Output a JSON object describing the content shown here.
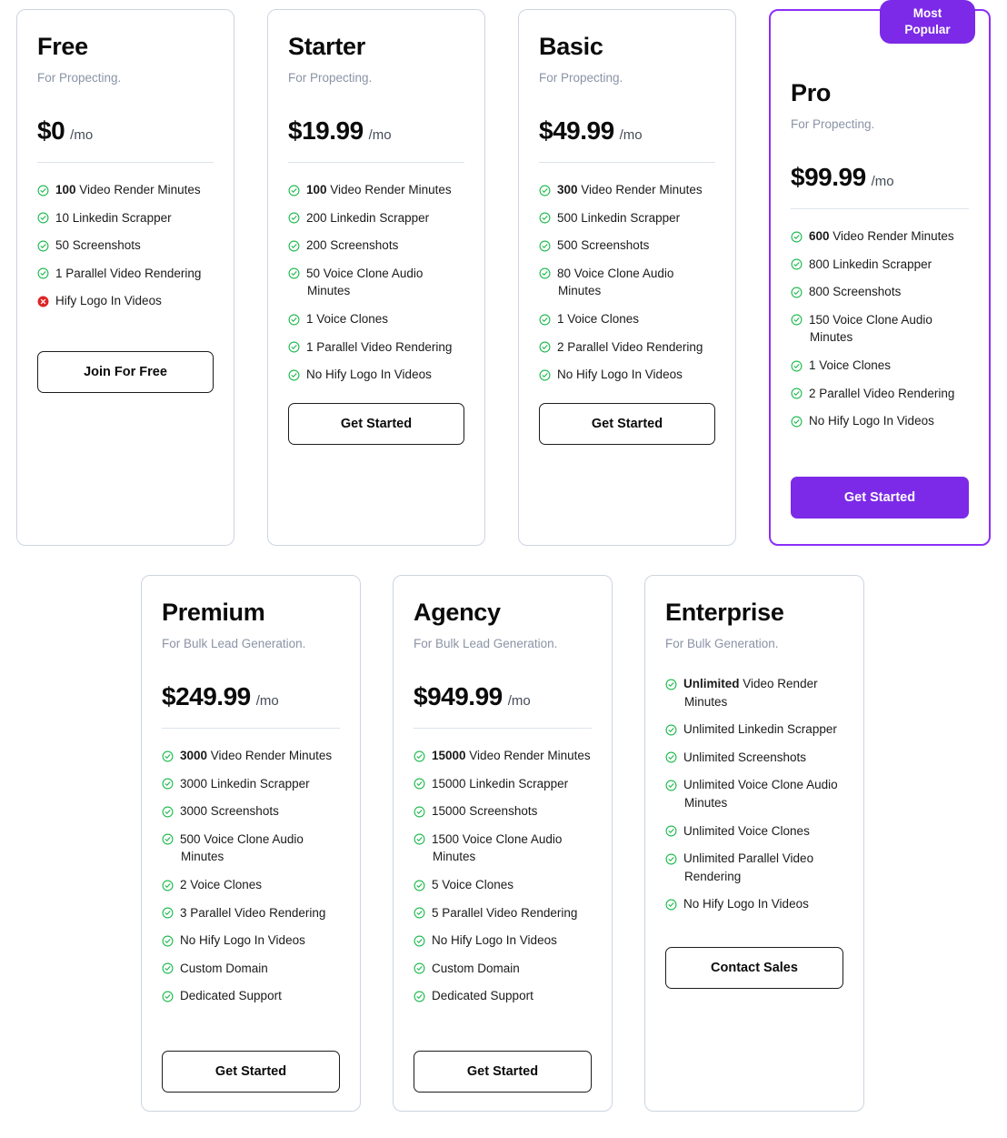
{
  "badge": {
    "line1": "Most",
    "line2": "Popular"
  },
  "colors": {
    "accent": "#7c2ae8",
    "featured_border": "#8b2ff7",
    "card_border": "#cdd5e0",
    "check": "#18b84a",
    "cross": "#e02424",
    "subtitle": "#8a94a6"
  },
  "plans": [
    {
      "name": "Free",
      "subtitle": "For Propecting.",
      "price": "$0",
      "period": "/mo",
      "cta": "Join For Free",
      "features": [
        {
          "icon": "check-icon",
          "strong": "100",
          "text": " Video Render Minutes"
        },
        {
          "icon": "check-icon",
          "strong": "",
          "text": "10 Linkedin Scrapper"
        },
        {
          "icon": "check-icon",
          "strong": "",
          "text": "50 Screenshots"
        },
        {
          "icon": "check-icon",
          "strong": "",
          "text": "1 Parallel Video Rendering"
        },
        {
          "icon": "cross-icon",
          "strong": "",
          "text": "Hify Logo In Videos"
        }
      ]
    },
    {
      "name": "Starter",
      "subtitle": "For Propecting.",
      "price": "$19.99",
      "period": "/mo",
      "cta": "Get Started",
      "features": [
        {
          "icon": "check-icon",
          "strong": "100",
          "text": " Video Render Minutes"
        },
        {
          "icon": "check-icon",
          "strong": "",
          "text": "200 Linkedin Scrapper"
        },
        {
          "icon": "check-icon",
          "strong": "",
          "text": "200 Screenshots"
        },
        {
          "icon": "check-icon",
          "strong": "",
          "text": "50 Voice Clone Audio Minutes"
        },
        {
          "icon": "check-icon",
          "strong": "",
          "text": "1 Voice Clones"
        },
        {
          "icon": "check-icon",
          "strong": "",
          "text": "1 Parallel Video Rendering"
        },
        {
          "icon": "check-icon",
          "strong": "",
          "text": "No Hify Logo In Videos"
        }
      ]
    },
    {
      "name": "Basic",
      "subtitle": "For Propecting.",
      "price": "$49.99",
      "period": "/mo",
      "cta": "Get Started",
      "features": [
        {
          "icon": "check-icon",
          "strong": "300",
          "text": " Video Render Minutes"
        },
        {
          "icon": "check-icon",
          "strong": "",
          "text": "500 Linkedin Scrapper"
        },
        {
          "icon": "check-icon",
          "strong": "",
          "text": "500 Screenshots"
        },
        {
          "icon": "check-icon",
          "strong": "",
          "text": "80 Voice Clone Audio Minutes"
        },
        {
          "icon": "check-icon",
          "strong": "",
          "text": "1 Voice Clones"
        },
        {
          "icon": "check-icon",
          "strong": "",
          "text": "2 Parallel Video Rendering"
        },
        {
          "icon": "check-icon",
          "strong": "",
          "text": "No Hify Logo In Videos"
        }
      ]
    },
    {
      "name": "Pro",
      "subtitle": "For Propecting.",
      "price": "$99.99",
      "period": "/mo",
      "cta": "Get Started",
      "featured": true,
      "features": [
        {
          "icon": "check-icon",
          "strong": "600",
          "text": " Video Render Minutes"
        },
        {
          "icon": "check-icon",
          "strong": "",
          "text": "800 Linkedin Scrapper"
        },
        {
          "icon": "check-icon",
          "strong": "",
          "text": "800 Screenshots"
        },
        {
          "icon": "check-icon",
          "strong": "",
          "text": "150 Voice Clone Audio Minutes"
        },
        {
          "icon": "check-icon",
          "strong": "",
          "text": "1 Voice Clones"
        },
        {
          "icon": "check-icon",
          "strong": "",
          "text": "2 Parallel Video Rendering"
        },
        {
          "icon": "check-icon",
          "strong": "",
          "text": "No Hify Logo In Videos"
        }
      ]
    },
    {
      "name": "Premium",
      "subtitle": "For Bulk Lead Generation.",
      "price": "$249.99",
      "period": "/mo",
      "cta": "Get Started",
      "features": [
        {
          "icon": "check-icon",
          "strong": "3000",
          "text": " Video Render Minutes"
        },
        {
          "icon": "check-icon",
          "strong": "",
          "text": "3000 Linkedin Scrapper"
        },
        {
          "icon": "check-icon",
          "strong": "",
          "text": "3000 Screenshots"
        },
        {
          "icon": "check-icon",
          "strong": "",
          "text": "500 Voice Clone Audio Minutes"
        },
        {
          "icon": "check-icon",
          "strong": "",
          "text": "2 Voice Clones"
        },
        {
          "icon": "check-icon",
          "strong": "",
          "text": "3 Parallel Video Rendering"
        },
        {
          "icon": "check-icon",
          "strong": "",
          "text": "No Hify Logo In Videos"
        },
        {
          "icon": "check-icon",
          "strong": "",
          "text": "Custom Domain"
        },
        {
          "icon": "check-icon",
          "strong": "",
          "text": "Dedicated Support"
        }
      ]
    },
    {
      "name": "Agency",
      "subtitle": "For Bulk Lead Generation.",
      "price": "$949.99",
      "period": "/mo",
      "cta": "Get Started",
      "features": [
        {
          "icon": "check-icon",
          "strong": "15000",
          "text": " Video Render Minutes"
        },
        {
          "icon": "check-icon",
          "strong": "",
          "text": "15000 Linkedin Scrapper"
        },
        {
          "icon": "check-icon",
          "strong": "",
          "text": "15000 Screenshots"
        },
        {
          "icon": "check-icon",
          "strong": "",
          "text": "1500 Voice Clone Audio Minutes"
        },
        {
          "icon": "check-icon",
          "strong": "",
          "text": "5 Voice Clones"
        },
        {
          "icon": "check-icon",
          "strong": "",
          "text": "5 Parallel Video Rendering"
        },
        {
          "icon": "check-icon",
          "strong": "",
          "text": "No Hify Logo In Videos"
        },
        {
          "icon": "check-icon",
          "strong": "",
          "text": "Custom Domain"
        },
        {
          "icon": "check-icon",
          "strong": "",
          "text": "Dedicated Support"
        }
      ]
    },
    {
      "name": "Enterprise",
      "subtitle": "For Bulk Generation.",
      "price": "",
      "period": "",
      "cta": "Contact Sales",
      "features": [
        {
          "icon": "check-icon",
          "strong": "Unlimited",
          "text": " Video Render Minutes"
        },
        {
          "icon": "check-icon",
          "strong": "",
          "text": "Unlimited Linkedin Scrapper"
        },
        {
          "icon": "check-icon",
          "strong": "",
          "text": "Unlimited Screenshots"
        },
        {
          "icon": "check-icon",
          "strong": "",
          "text": "Unlimited Voice Clone Audio Minutes"
        },
        {
          "icon": "check-icon",
          "strong": "",
          "text": "Unlimited Voice Clones"
        },
        {
          "icon": "check-icon",
          "strong": "",
          "text": "Unlimited Parallel Video Rendering"
        },
        {
          "icon": "check-icon",
          "strong": "",
          "text": "No Hify Logo In Videos"
        }
      ]
    }
  ]
}
